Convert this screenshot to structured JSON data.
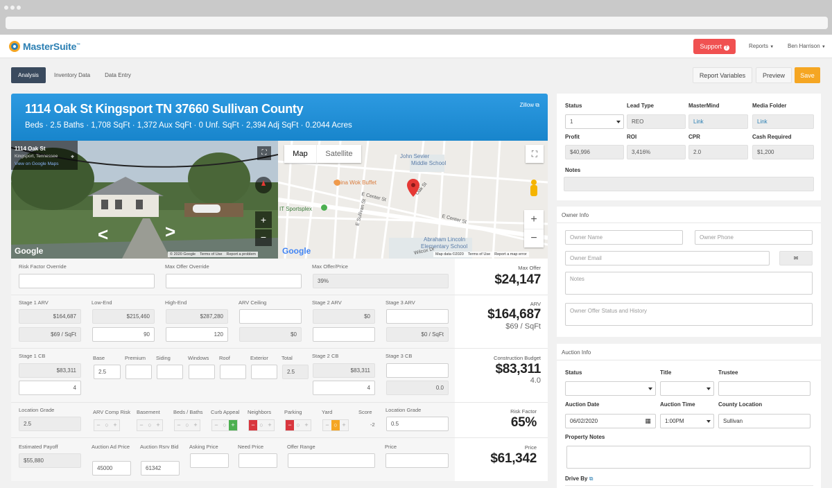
{
  "brand": {
    "name": "MasterSuite",
    "tm": "™"
  },
  "topnav": {
    "support": "Support",
    "reports": "Reports",
    "user": "Ben Harrison"
  },
  "tabs": [
    "Analysis",
    "Inventory Data",
    "Data Entry"
  ],
  "actions": {
    "report_variables": "Report Variables",
    "preview": "Preview",
    "save": "Save"
  },
  "property": {
    "title": "1114 Oak St Kingsport TN 37660 Sullivan County",
    "subtitle": "Beds · 2.5 Baths · 1,708 SqFt · 1,372 Aux SqFt · 0 Unf. SqFt · 2,394 Adj SqFt · 0.2044 Acres",
    "zillow": "Zillow"
  },
  "streetview": {
    "address": "1114 Oak St",
    "city": "Kingsport, Tennessee",
    "maps_link": "View on Google Maps",
    "google": "Google",
    "footer": [
      "© 2020 Google",
      "Terms of Use",
      "Report a problem"
    ]
  },
  "map": {
    "tab_map": "Map",
    "tab_satellite": "Satellite",
    "google": "Google",
    "footer": [
      "Map data ©2020",
      "Terms of Use",
      "Report a map error"
    ],
    "labels": {
      "school1": "John Sevier",
      "school1b": "Middle School",
      "restaurant": "China Wok Buffet",
      "sports": "IT Sportsplex",
      "school2": "Abraham Lincoln",
      "school2b": "Elementary School",
      "e_center1": "E Center St",
      "e_center2": "E Center St",
      "oak": "Oak St",
      "sullivan": "E Sullivan St",
      "wilcox": "Wilcox Dr"
    }
  },
  "risk": {
    "risk_factor_override_label": "Risk Factor Override",
    "max_offer_override_label": "Max Offer Override",
    "max_offer_price_label": "Max Offer/Price",
    "max_offer_price_value": "39%",
    "max_offer_label": "Max Offer",
    "max_offer_value": "$24,147"
  },
  "arv": {
    "stage1_label": "Stage 1 ARV",
    "low_label": "Low-End",
    "high_label": "High-End",
    "ceiling_label": "ARV Ceiling",
    "stage2_label": "Stage 2 ARV",
    "stage3_label": "Stage 3 ARV",
    "stage1_value": "$164,687",
    "stage1_sqft": "$69 / SqFt",
    "low_value": "$215,460",
    "low_pct": "90",
    "high_value": "$287,280",
    "high_pct": "120",
    "ceiling_value": "$0",
    "stage2_value": "$0",
    "stage3_sqft": "$0 / SqFt",
    "arv_label": "ARV",
    "arv_value": "$164,687",
    "arv_sqft": "$69 / SqFt"
  },
  "cb": {
    "stage1_label": "Stage 1 CB",
    "stage1_value": "$83,311",
    "stage1_num": "4",
    "base_label": "Base",
    "base_value": "2.5",
    "premium_label": "Premium",
    "siding_label": "Siding",
    "windows_label": "Windows",
    "roof_label": "Roof",
    "exterior_label": "Exterior",
    "total_label": "Total",
    "total_value": "2.5",
    "stage2_label": "Stage 2 CB",
    "stage2_value": "$83,311",
    "stage2_num": "4",
    "stage3_label": "Stage 3 CB",
    "stage3_num": "0.0",
    "budget_label": "Construction Budget",
    "budget_value": "$83,311",
    "budget_sub": "4.0"
  },
  "location": {
    "grade_label": "Location Grade",
    "grade_value": "2.5",
    "comp_label": "ARV Comp Risk",
    "basement_label": "Basement",
    "beds_label": "Beds / Baths",
    "curb_label": "Curb Appeal",
    "neighbors_label": "Neighbors",
    "parking_label": "Parking",
    "yard_label": "Yard",
    "score_label": "Score",
    "score_value": "-2",
    "grade2_label": "Location Grade",
    "grade2_value": "0.5",
    "risk_label": "Risk Factor",
    "risk_value": "65%"
  },
  "payoff": {
    "est_label": "Estimated Payoff",
    "est_value": "$55,880",
    "ad_label": "Auction Ad Price",
    "ad_value": "45000",
    "rsrv_label": "Auction Rsrv Bid",
    "rsrv_value": "61342",
    "asking_label": "Asking Price",
    "need_label": "Need Price",
    "range_label": "Offer Range",
    "price_label": "Price",
    "price_label2": "Price",
    "price_value": "$61,342"
  },
  "status_panel": {
    "status_label": "Status",
    "status_value": "1",
    "lead_label": "Lead Type",
    "lead_value": "REO",
    "mastermind_label": "MasterMind",
    "mastermind_value": "Link",
    "media_label": "Media Folder",
    "media_value": "Link",
    "profit_label": "Profit",
    "profit_value": "$40,996",
    "roi_label": "ROI",
    "roi_value": "3,416%",
    "cpr_label": "CPR",
    "cpr_value": "2.0",
    "cash_label": "Cash Required",
    "cash_value": "$1,200",
    "notes_label": "Notes"
  },
  "owner": {
    "title": "Owner Info",
    "name_ph": "Owner Name",
    "phone_ph": "Owner Phone",
    "email_ph": "Owner Email",
    "notes_ph": "Notes",
    "history_ph": "Owner Offer Status and History"
  },
  "auction": {
    "title": "Auction Info",
    "status_label": "Status",
    "title_label": "Title",
    "trustee_label": "Trustee",
    "date_label": "Auction Date",
    "date_value": "06/02/2020",
    "time_label": "Auction Time",
    "time_value": "1:00PM",
    "county_label": "County Location",
    "county_value": "Sullivan",
    "notes_label": "Property Notes",
    "driveby_label": "Drive By"
  },
  "colors": {
    "brand_blue": "#2b7fb3",
    "support_red": "#f05151",
    "save_orange": "#f5a623",
    "tab_dark": "#3a4a5e",
    "minus_red": "#d9363e",
    "plus_green": "#4caf50",
    "mid_yellow": "#f5a623"
  }
}
